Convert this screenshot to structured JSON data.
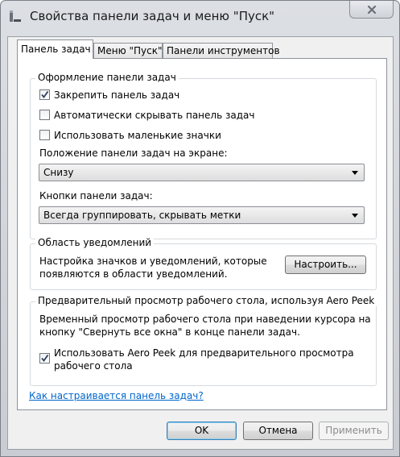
{
  "window": {
    "title": "Свойства панели задач и меню \"Пуск\""
  },
  "tabs": [
    {
      "label": "Панель задач",
      "active": true
    },
    {
      "label": "Меню \"Пуск\"",
      "active": false
    },
    {
      "label": "Панели инструментов",
      "active": false
    }
  ],
  "appearance": {
    "legend": "Оформление панели задач",
    "lock_label": "Закрепить панель задач",
    "lock_checked": true,
    "autohide_label": "Автоматически скрывать панель задач",
    "autohide_checked": false,
    "small_icons_label": "Использовать маленькие значки",
    "small_icons_checked": false,
    "position_label": "Положение панели задач на экране:",
    "position_value": "Снизу",
    "buttons_label": "Кнопки панели задач:",
    "buttons_value": "Всегда группировать, скрывать метки"
  },
  "notifications": {
    "legend": "Область уведомлений",
    "line1": "Настройка значков и уведомлений, которые",
    "line2": "появляются в области уведомлений.",
    "customize_label": "Настроить..."
  },
  "aero": {
    "legend": "Предварительный просмотр рабочего стола, используя Aero Peek",
    "desc1": "Временный просмотр рабочего стола при наведении курсора на",
    "desc2": "кнопку \"Свернуть все окна\" в конце панели задач.",
    "check_line1": "Использовать Aero Peek для предварительного просмотра",
    "check_line2": "рабочего стола",
    "checked": true
  },
  "help_link": "Как настраивается панель задач?",
  "buttons": {
    "ok": "OK",
    "cancel": "Отмена",
    "apply": "Применить"
  }
}
